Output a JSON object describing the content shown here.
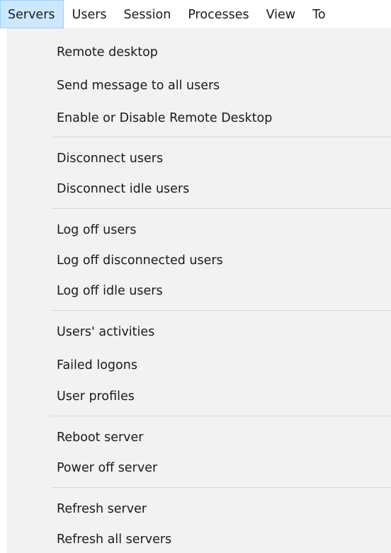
{
  "menubar": {
    "items": [
      {
        "label": "Servers"
      },
      {
        "label": "Users"
      },
      {
        "label": "Session"
      },
      {
        "label": "Processes"
      },
      {
        "label": "View"
      },
      {
        "label": "To"
      }
    ]
  },
  "dropdown": {
    "groups": [
      {
        "items": [
          "Remote desktop",
          "Send message to all users",
          "Enable or Disable Remote Desktop"
        ]
      },
      {
        "items": [
          "Disconnect users",
          "Disconnect idle users"
        ]
      },
      {
        "items": [
          "Log off users",
          "Log off disconnected users",
          "Log off idle users"
        ]
      },
      {
        "items": [
          "Users' activities",
          "Failed logons",
          "User profiles"
        ]
      },
      {
        "items": [
          "Reboot server",
          "Power off server"
        ]
      },
      {
        "items": [
          "Refresh server",
          "Refresh all servers"
        ]
      }
    ]
  },
  "colors": {
    "menu_background": "#f2f2f2",
    "active_highlight": "#cce8ff",
    "active_border": "#99d1ff",
    "separator": "#d7d7d7"
  }
}
